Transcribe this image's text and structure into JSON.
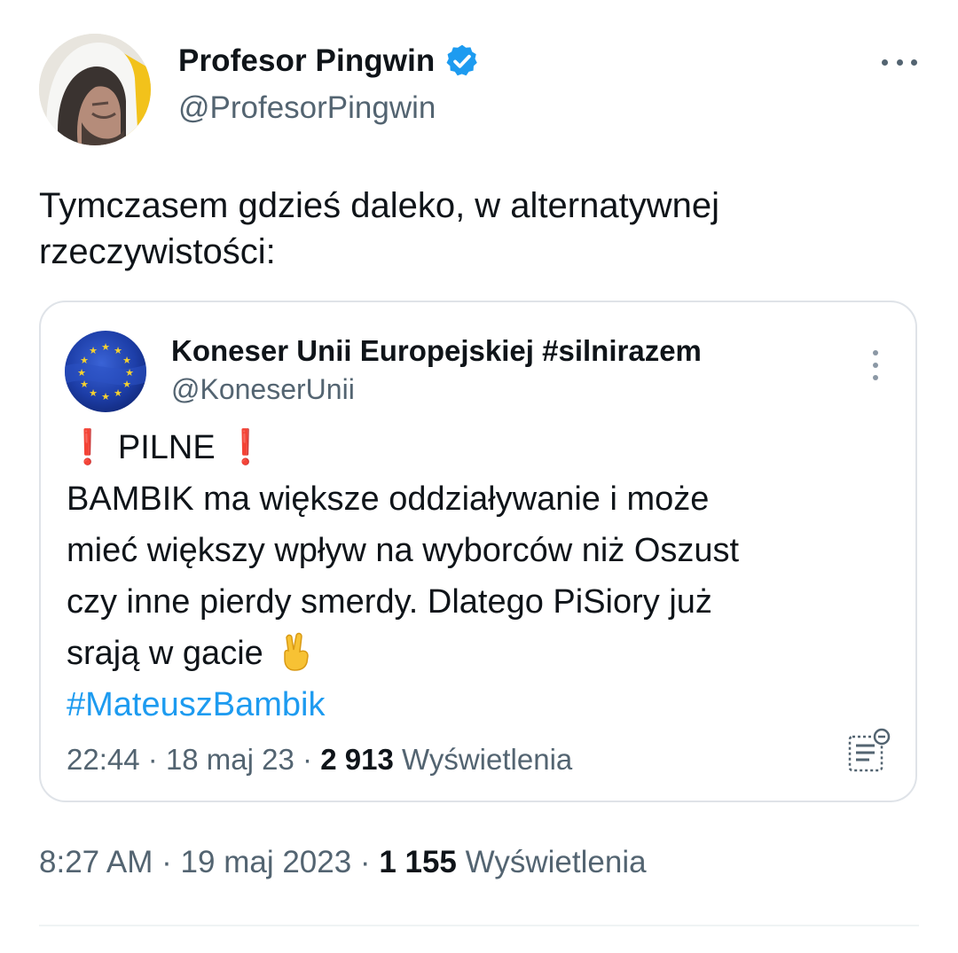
{
  "tweet": {
    "author": {
      "name": "Profesor Pingwin",
      "handle": "@ProfesorPingwin",
      "verified_icon": "verified-badge-icon"
    },
    "text_line1": "Tymczasem gdzieś daleko, w alternatywnej",
    "text_line2": "rzeczywistości:",
    "time": "8:27 AM",
    "sep1": "·",
    "date": "19 maj 2023",
    "sep2": "·",
    "views_count": "1 155",
    "views_label": "Wyświetlenia",
    "more_icon": "more-horizontal-icon"
  },
  "quote": {
    "author": {
      "name": "Koneser Unii Europejskiej #silnirazem",
      "handle": "@KoneserUnii"
    },
    "alert_marker_left": "❗",
    "alert_word": "PILNE",
    "alert_marker_right": "❗",
    "lines": [
      "BAMBIK ma większe oddziaływanie i może",
      "mieć większy wpływ na wyborców niż Oszust",
      "czy inne pierdy smerdy. Dlatego PiSiory już",
      "srają w gacie"
    ],
    "emoji": "victory-hand-emoji",
    "hashtag": "#MateuszBambik",
    "meta_time": "22:44",
    "meta_sep1": "·",
    "meta_date": "18 maj 23",
    "meta_sep2": "·",
    "meta_views_count": "2 913",
    "meta_views_label": "Wyświetlenia",
    "kebab_icon": "more-vertical-icon",
    "doc_icon": "document-lines-icon"
  },
  "colors": {
    "text": "#0f1419",
    "muted": "#536471",
    "link": "#1d9bf0",
    "verified": "#1d9bf0",
    "alert": "#e0243b",
    "border": "#dfe3e8"
  }
}
